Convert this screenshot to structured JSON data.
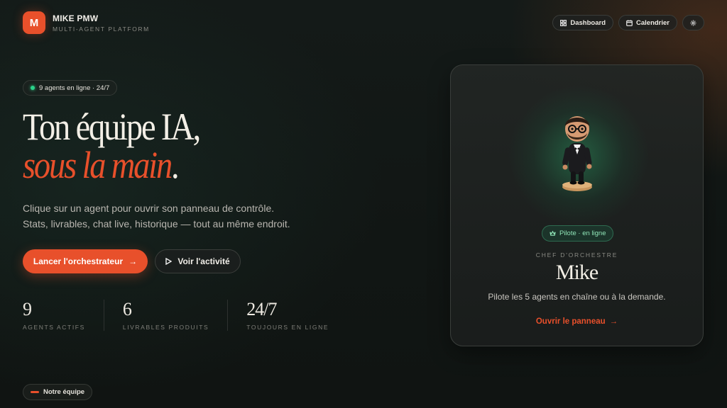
{
  "brand": {
    "logo_letter": "M",
    "name": "MIKE PMW",
    "subtitle": "MULTI-AGENT PLATFORM"
  },
  "nav": {
    "dashboard": "Dashboard",
    "calendar": "Calendrier",
    "settings_icon": "gear-icon"
  },
  "hero": {
    "status": "9 agents en ligne · 24/7",
    "headline_line1": "Ton équipe IA,",
    "headline_line2": "sous la main",
    "headline_period": ".",
    "desc_line1": "Clique sur un agent pour ouvrir son panneau de contrôle.",
    "desc_line2": "Stats, livrables, chat live, historique — tout au même endroit.",
    "cta_primary": "Lancer l'orchestrateur",
    "cta_secondary": "Voir l'activité"
  },
  "stats": [
    {
      "value": "9",
      "label": "AGENTS ACTIFS"
    },
    {
      "value": "6",
      "label": "LIVRABLES PRODUITS"
    },
    {
      "value": "24/7",
      "label": "TOUJOURS EN LIGNE"
    }
  ],
  "section": {
    "label": "Notre équipe"
  },
  "card": {
    "badge": "Pilote · en ligne",
    "role": "CHEF D'ORCHESTRE",
    "name": "Mike",
    "description": "Pilote les 5 agents en chaîne ou à la demande.",
    "link": "Ouvrir le panneau"
  },
  "colors": {
    "accent": "#e8502b",
    "online": "#2bd28a",
    "background": "#121715"
  }
}
